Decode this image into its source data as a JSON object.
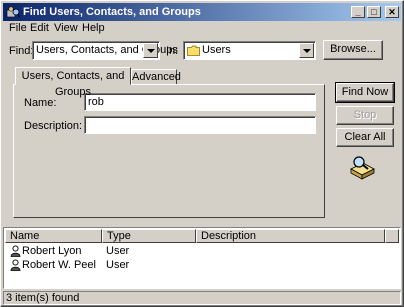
{
  "window": {
    "title": "Find Users, Contacts, and Groups",
    "controls": {
      "minimize": "_",
      "maximize": "□",
      "close": "✕"
    }
  },
  "menu": [
    "File",
    "Edit",
    "View",
    "Help"
  ],
  "find": {
    "label": "Find:",
    "value": "Users, Contacts, and Groups"
  },
  "in": {
    "label": "In:",
    "value": "Users",
    "icon": "folder-icon"
  },
  "browse_label": "Browse...",
  "tabs": [
    {
      "label": "Users, Contacts, and Groups",
      "active": true
    },
    {
      "label": "Advanced",
      "active": false
    }
  ],
  "form": {
    "name_label": "Name:",
    "name_value": "rob",
    "description_label": "Description:",
    "description_value": ""
  },
  "buttons": {
    "find_now": "Find Now",
    "stop": "Stop",
    "clear_all": "Clear All"
  },
  "results": {
    "columns": [
      "Name",
      "Type",
      "Description"
    ],
    "rows": [
      {
        "name": "Robert Lyon",
        "type": "User",
        "description": ""
      },
      {
        "name": "Robert W. Peel",
        "type": "User",
        "description": ""
      }
    ]
  },
  "status": "3 item(s) found"
}
